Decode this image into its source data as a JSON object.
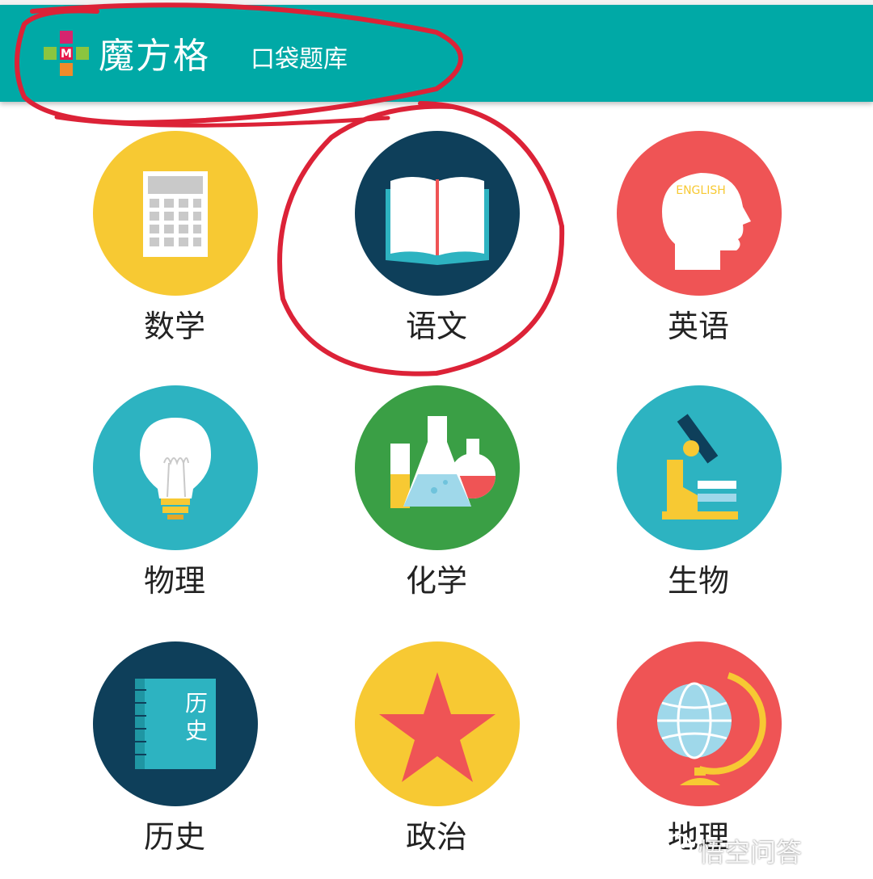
{
  "header": {
    "brand": "魔方格",
    "subtitle": "口袋题库",
    "logo_letter": "M",
    "bg_color": "#00a9a6"
  },
  "subjects": [
    {
      "label": "数学",
      "icon": "calculator-icon",
      "color": "#f7c933"
    },
    {
      "label": "语文",
      "icon": "open-book-icon",
      "color": "#0e3f5a"
    },
    {
      "label": "英语",
      "icon": "english-head-icon",
      "color": "#ef5455",
      "icon_text": "ENGLISH"
    },
    {
      "label": "物理",
      "icon": "light-bulb-icon",
      "color": "#2db3c1"
    },
    {
      "label": "化学",
      "icon": "flasks-icon",
      "color": "#3a9f45"
    },
    {
      "label": "生物",
      "icon": "microscope-icon",
      "color": "#2db3c1"
    },
    {
      "label": "历史",
      "icon": "history-book-icon",
      "color": "#0e3f5a",
      "icon_text_1": "历",
      "icon_text_2": "史"
    },
    {
      "label": "政治",
      "icon": "star-icon",
      "color": "#f7c933"
    },
    {
      "label": "地理",
      "icon": "globe-icon",
      "color": "#ef5455"
    }
  ],
  "watermark": "悟空问答"
}
